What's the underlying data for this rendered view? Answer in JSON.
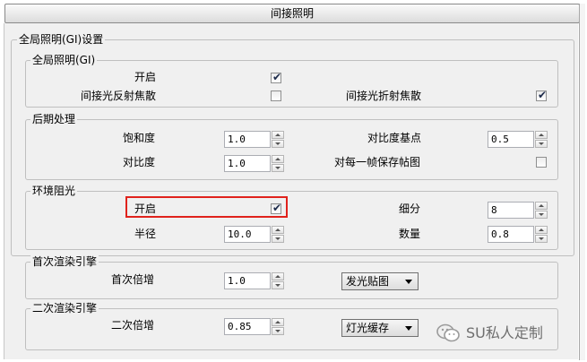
{
  "rollout": {
    "title": "间接照明"
  },
  "gi_settings": {
    "title": "全局照明(GI)设置",
    "gi": {
      "title": "全局照明(GI)",
      "enable_label": "开启",
      "enable_checked": true,
      "reflective_caustics_label": "间接光反射焦散",
      "reflective_caustics_checked": false,
      "refractive_caustics_label": "间接光折射焦散",
      "refractive_caustics_checked": true
    },
    "post": {
      "title": "后期处理",
      "saturation_label": "饱和度",
      "saturation_value": "1.0",
      "contrast_base_label": "对比度基点",
      "contrast_base_value": "0.5",
      "contrast_label": "对比度",
      "contrast_value": "1.0",
      "save_maps_label": "对每一帧保存帖图",
      "save_maps_checked": false
    },
    "ao": {
      "title": "环境阻光",
      "enable_label": "开启",
      "enable_checked": true,
      "subdivs_label": "细分",
      "subdivs_value": "8",
      "radius_label": "半径",
      "radius_value": "10.0",
      "amount_label": "数量",
      "amount_value": "0.8"
    }
  },
  "primary": {
    "title": "首次渲染引擎",
    "multiplier_label": "首次倍增",
    "multiplier_value": "1.0",
    "engine": "发光贴图"
  },
  "secondary": {
    "title": "二次渲染引擎",
    "multiplier_label": "二次倍增",
    "multiplier_value": "0.85",
    "engine": "灯光缓存"
  },
  "watermark": {
    "text": "SU私人定制",
    "icon": "wechat-icon"
  },
  "colors": {
    "highlight": "#e0221c",
    "panel": "#f0f0f0"
  }
}
